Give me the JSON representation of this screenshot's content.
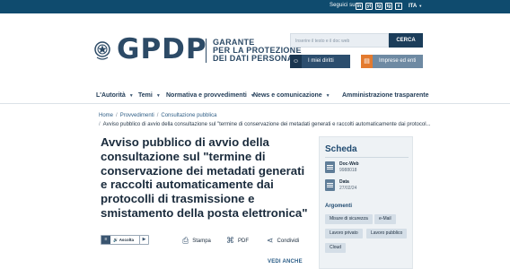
{
  "topbar": {
    "follow_label": "Seguici su",
    "socials": [
      "in",
      "yt",
      "ig",
      "tg",
      "x"
    ],
    "language": "ITA",
    "background": "#0f4b6e"
  },
  "header": {
    "logo_text": "GPDP",
    "org_line1": "GARANTE",
    "org_line2": "PER LA PROTEZIONE",
    "org_line3": "DEI DATI PERSONALI",
    "search_placeholder": "Inserire il testo e il doc web",
    "search_button": "CERCA",
    "rights_button": "I miei diritti",
    "business_button": "Imprese ed enti",
    "accent_orange": "#e37a2e"
  },
  "nav": {
    "items": [
      {
        "label": "L'Autorità",
        "icon": "chevron-down-icon"
      },
      {
        "label": "Temi",
        "icon": "chevron-down-icon"
      },
      {
        "label": "Normativa e provvedimenti",
        "icon": "chevron-down-icon"
      },
      {
        "label": "News e comunicazione",
        "icon": "chevron-down-icon"
      },
      {
        "label": "Amministrazione trasparente"
      }
    ]
  },
  "breadcrumb": {
    "home": "Home",
    "level1": "Provvedimenti",
    "level2": "Consultazione pubblica",
    "current": "Avviso pubblico di avvio della consultazione sul \"termine di conservazione dei metadati generati e raccolti automaticamente dai protocol..."
  },
  "article": {
    "title": "Avviso pubblico di avvio della consultazione sul \"termine di conservazione dei metadati generati e raccolti automaticamente dai protocolli di trasmissione e smistamento della posta elettronica\"",
    "listen_label": "Ascolta",
    "print_label": "Stampa",
    "pdf_label": "PDF",
    "share_label": "Condividi",
    "see_also": "VEDI ANCHE"
  },
  "sidebar": {
    "title": "Scheda",
    "docweb_label": "Doc-Web",
    "docweb_value": "9988018",
    "date_label": "Data",
    "date_value": "27/02/24",
    "topics_title": "Argomenti",
    "tags": [
      "Misure di sicurezza",
      "e-Mail",
      "Lavoro privato",
      "Lavoro pubblico",
      "Cloud"
    ]
  }
}
